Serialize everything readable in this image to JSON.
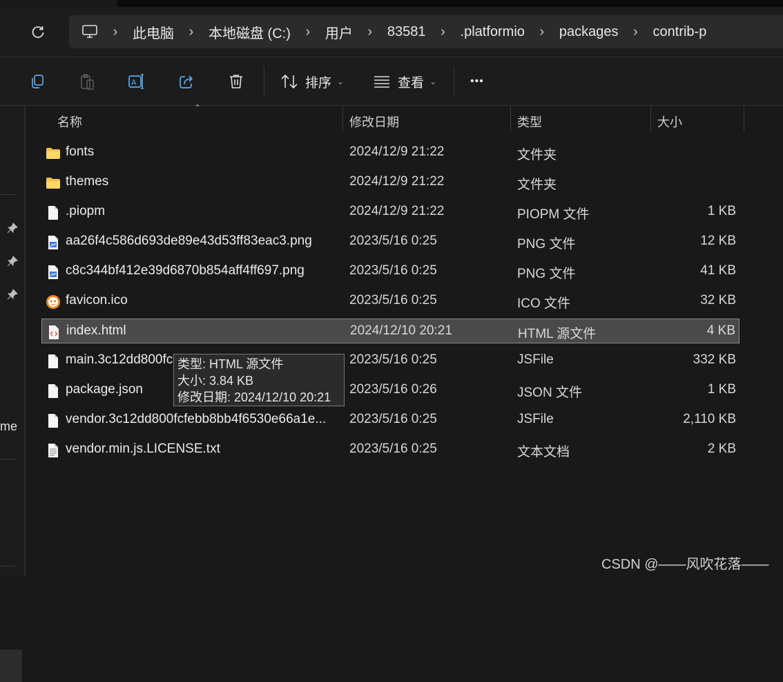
{
  "address": {
    "crumbs": [
      "此电脑",
      "本地磁盘 (C:)",
      "用户",
      "83581",
      ".platformio",
      "packages",
      "contrib-p"
    ],
    "icons": [
      "refresh-icon",
      "computer-icon",
      "chevron-right-icon"
    ]
  },
  "toolbar": {
    "icons": [
      "copy-icon",
      "paste-icon",
      "rename-icon",
      "share-icon",
      "delete-icon",
      "sort-icon",
      "view-icon",
      "more-icon"
    ],
    "sort_label": "排序",
    "view_label": "查看",
    "more_label": "•••"
  },
  "nav": {
    "partial_label": "me"
  },
  "columns": {
    "name": "名称",
    "date": "修改日期",
    "type": "类型",
    "size": "大小"
  },
  "files": [
    {
      "name": "fonts",
      "date": "2024/12/9 21:22",
      "type": "文件夹",
      "size": "",
      "icon": "folder-icon"
    },
    {
      "name": "themes",
      "date": "2024/12/9 21:22",
      "type": "文件夹",
      "size": "",
      "icon": "folder-icon"
    },
    {
      "name": ".piopm",
      "date": "2024/12/9 21:22",
      "type": "PIOPM 文件",
      "size": "1 KB",
      "icon": "file-icon"
    },
    {
      "name": "aa26f4c586d693de89e43d53ff83eac3.png",
      "date": "2023/5/16 0:25",
      "type": "PNG 文件",
      "size": "12 KB",
      "icon": "image-file-icon"
    },
    {
      "name": "c8c344bf412e39d6870b854aff4ff697.png",
      "date": "2023/5/16 0:25",
      "type": "PNG 文件",
      "size": "41 KB",
      "icon": "image-file-icon"
    },
    {
      "name": "favicon.ico",
      "date": "2023/5/16 0:25",
      "type": "ICO 文件",
      "size": "32 KB",
      "icon": "favicon-icon"
    },
    {
      "name": "index.html",
      "date": "2024/12/10 20:21",
      "type": "HTML 源文件",
      "size": "4 KB",
      "icon": "html-file-icon"
    },
    {
      "name": "main.3c12dd800fc",
      "date": "2023/5/16 0:25",
      "type": "JSFile",
      "size": "332 KB",
      "icon": "file-icon"
    },
    {
      "name": "package.json",
      "date": "2023/5/16 0:26",
      "type": "JSON 文件",
      "size": "1 KB",
      "icon": "file-icon"
    },
    {
      "name": "vendor.3c12dd800fcfebb8bb4f6530e66a1e...",
      "date": "2023/5/16 0:25",
      "type": "JSFile",
      "size": "2,110 KB",
      "icon": "file-icon"
    },
    {
      "name": "vendor.min.js.LICENSE.txt",
      "date": "2023/5/16 0:25",
      "type": "文本文档",
      "size": "2 KB",
      "icon": "text-file-icon"
    }
  ],
  "tooltip": {
    "type_line": "类型: HTML 源文件",
    "size_line": "大小: 3.84 KB",
    "date_line": "修改日期: 2024/12/10 20:21"
  },
  "watermark": "CSDN @——风吹花落——"
}
